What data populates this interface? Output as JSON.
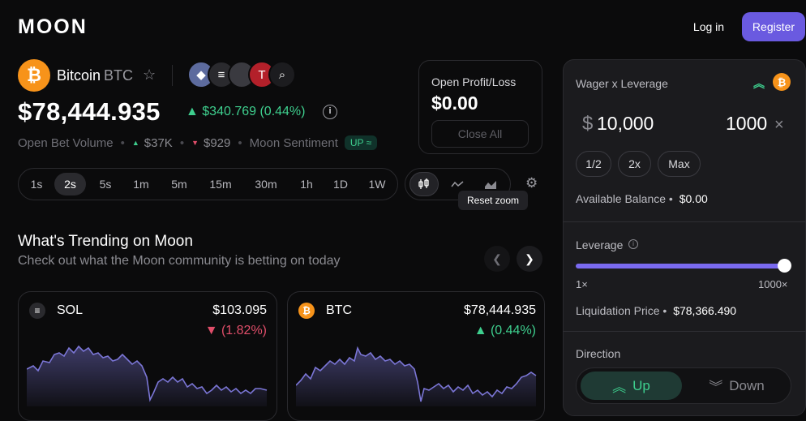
{
  "brand": {
    "logo": "MOON"
  },
  "header": {
    "login_label": "Log in",
    "register_label": "Register"
  },
  "asset": {
    "name": "Bitcoin",
    "ticker": "BTC",
    "icon_glyph": "₿",
    "price": "$78,444.935",
    "change": "▲ $340.769 (0.44%)",
    "related_tokens": [
      {
        "icon": "ethereum-icon",
        "glyph": "◆",
        "color": "#5d6b9e"
      },
      {
        "icon": "solana-icon",
        "glyph": "≡",
        "color": "#2a2a2e"
      },
      {
        "icon": "apple-icon",
        "glyph": "",
        "color": "#3a3a40"
      },
      {
        "icon": "tesla-icon",
        "glyph": "T",
        "color": "#b3202a"
      },
      {
        "icon": "search-icon",
        "glyph": "⌕",
        "color": "#1c1c1f"
      }
    ]
  },
  "stats": {
    "open_bet_volume_label": "Open Bet Volume",
    "up_volume": "$37K",
    "down_volume": "$929",
    "sentiment_label": "Moon Sentiment",
    "sentiment_badge": "UP ≈"
  },
  "pnl": {
    "label": "Open Profit/Loss",
    "value": "$0.00",
    "close_all_label": "Close All"
  },
  "timeframes": {
    "items": [
      "1s",
      "2s",
      "5s",
      "1m",
      "5m",
      "15m",
      "30m",
      "1h",
      "1D",
      "1W"
    ],
    "active": "2s"
  },
  "chart_types": [
    "candlestick-icon",
    "line-chart-icon",
    "area-chart-icon"
  ],
  "tooltip": "Reset zoom",
  "trending": {
    "title": "What's Trending on Moon",
    "subtitle": "Check out what the Moon community is betting on today",
    "cards": [
      {
        "name": "SOL",
        "price": "$103.095",
        "change": "▼ (1.82%)",
        "direction": "down",
        "icon_glyph": "≡",
        "icon_color": "#2a2a2e"
      },
      {
        "name": "BTC",
        "price": "$78,444.935",
        "change": "▲ (0.44%)",
        "direction": "up",
        "icon_glyph": "₿",
        "icon_color": "#f7931a"
      }
    ]
  },
  "trade_panel": {
    "wager_label": "Wager x Leverage",
    "currency_symbol": "$",
    "wager_value": "10,000",
    "leverage_value": "1000",
    "leverage_suffix": "×",
    "chips": [
      "1/2",
      "2x",
      "Max"
    ],
    "balance_label": "Available Balance",
    "balance_value": "$0.00",
    "leverage_label": "Leverage",
    "leverage_min": "1×",
    "leverage_max": "1000×",
    "leverage_fraction": 1.0,
    "liquidation_label": "Liquidation Price",
    "liquidation_value": "$78,366.490",
    "direction_label": "Direction",
    "up_label": "Up",
    "down_label": "Down"
  },
  "colors": {
    "accent": "#6a5ae0",
    "up": "#3ecf8e",
    "down": "#e04e6a",
    "btc": "#f7931a",
    "spark": "#7b76d6"
  }
}
